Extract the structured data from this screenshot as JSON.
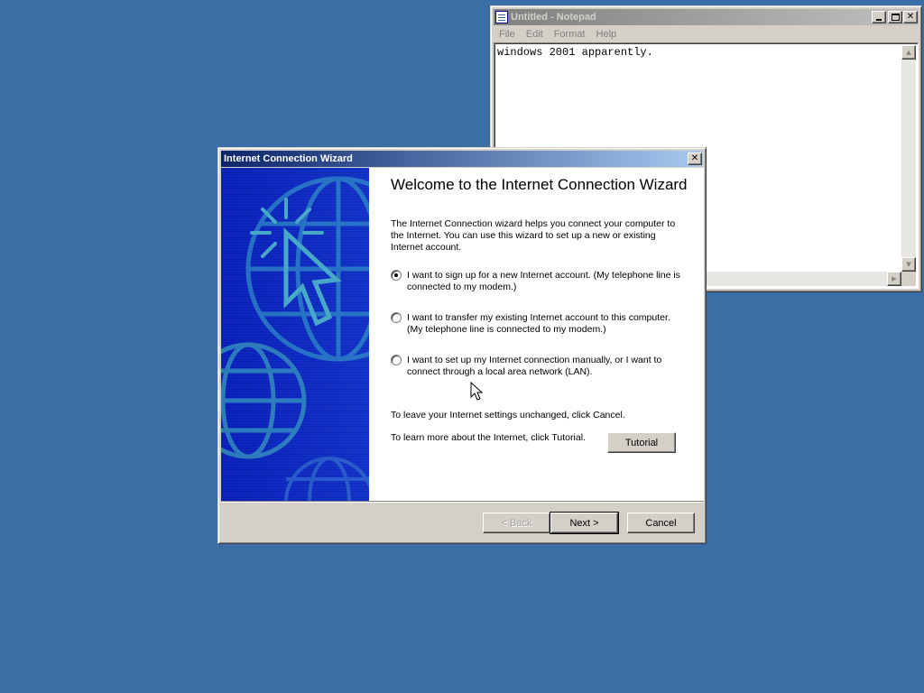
{
  "notepad": {
    "title": "Untitled - Notepad",
    "menu": [
      "File",
      "Edit",
      "Format",
      "Help"
    ],
    "text": "windows 2001 apparently."
  },
  "wizard": {
    "title": "Internet Connection Wizard",
    "heading": "Welcome to the Internet Connection Wizard",
    "intro": "The Internet Connection wizard helps you connect your computer to the Internet.  You can use this wizard to set up a new or existing Internet account.",
    "options": [
      {
        "label": "I want to sign up for a new Internet account. (My telephone line is connected to my modem.)",
        "selected": true
      },
      {
        "label": "I want to transfer my existing Internet account to this computer. (My telephone line is connected to my modem.)",
        "selected": false
      },
      {
        "label": "I want to set up my Internet connection manually, or I want to connect through a local area network (LAN).",
        "selected": false
      }
    ],
    "leave_text": "To leave your Internet settings unchanged, click Cancel.",
    "learn_text": "To learn more about the Internet, click Tutorial.",
    "tutorial_label": "Tutorial",
    "back_label": "< Back",
    "next_label": "Next >",
    "cancel_label": "Cancel"
  },
  "colors": {
    "desktop": "#3A6EA5",
    "active_title": "#0A246A",
    "side_panel": "#0A1EB4",
    "globe": "#48A8C8"
  },
  "icons": [
    "notepad-icon",
    "minimize-icon",
    "maximize-icon",
    "close-icon",
    "scroll-up-icon",
    "scroll-down-icon",
    "scroll-right-icon",
    "wizard-cursor-globe-graphic",
    "mouse-pointer-icon"
  ]
}
